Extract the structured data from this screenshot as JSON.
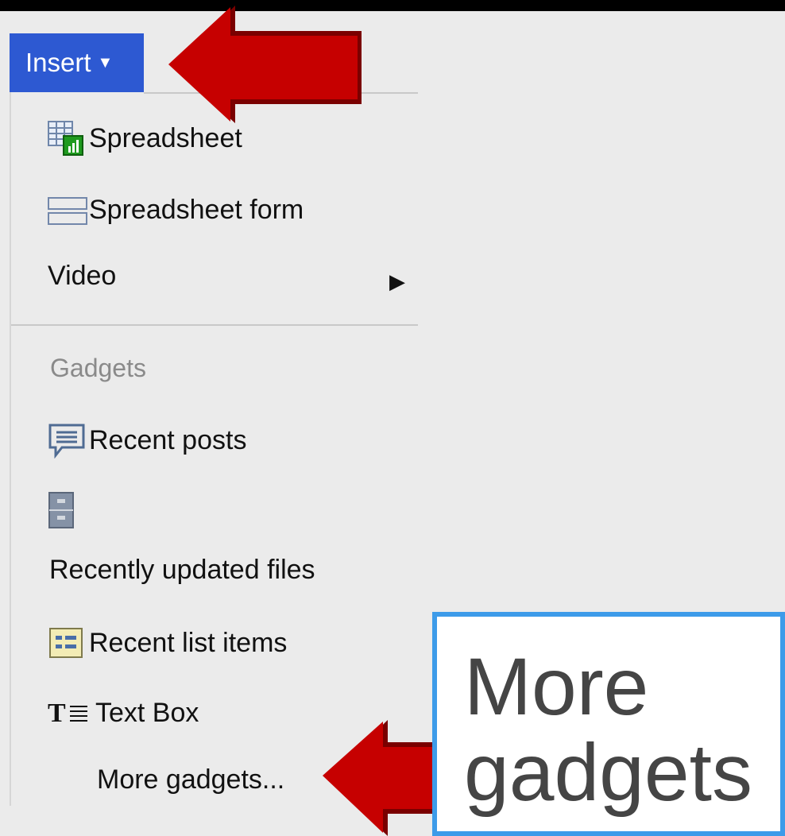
{
  "menu": {
    "button_label": "Insert",
    "caret_glyph": "▼",
    "items": [
      {
        "label": "Spreadsheet",
        "icon": "spreadsheet-icon"
      },
      {
        "label": "Spreadsheet form",
        "icon": "spreadsheet-form-icon"
      },
      {
        "label": "Video",
        "icon": "",
        "submenu_glyph": "▶"
      }
    ],
    "gadgets_header": "Gadgets",
    "gadgets": [
      {
        "label": "Recent posts",
        "icon": "recent-posts-icon"
      },
      {
        "label": "",
        "icon": "file-cabinet-icon"
      },
      {
        "label": "Recently updated files",
        "icon": ""
      },
      {
        "label": "Recent list items",
        "icon": "list-items-icon"
      },
      {
        "label": "Text Box",
        "icon": "text-box-icon"
      },
      {
        "label": "More gadgets...",
        "icon": ""
      }
    ]
  },
  "callout": {
    "line1": "More",
    "line2": "gadgets"
  },
  "colors": {
    "accent": "#2d59d2",
    "arrow": "#c00000",
    "callout_border": "#3d9be9"
  }
}
